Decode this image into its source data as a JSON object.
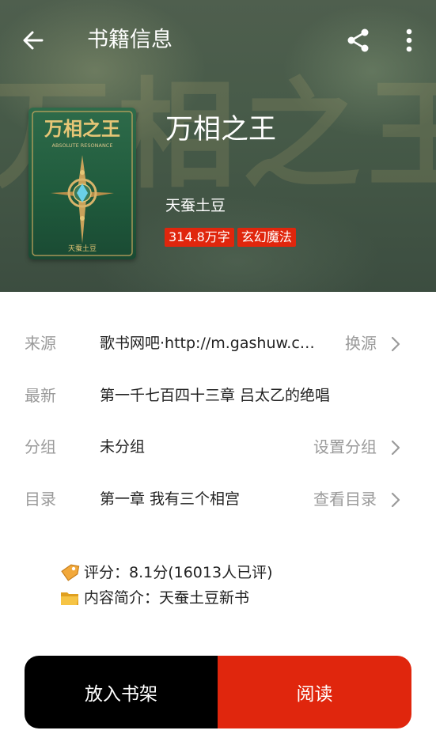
{
  "topbar": {
    "title": "书籍信息",
    "back_icon": "arrow-left-icon",
    "share_icon": "share-icon",
    "more_icon": "more-vertical-icon"
  },
  "book": {
    "title": "万相之王",
    "author": "天蚕土豆",
    "word_count": "314.8万字",
    "category": "玄幻魔法",
    "cover": {
      "title": "万相之王",
      "subtitle": "ABSOLUTE RESONANCE",
      "author": "天蚕土豆"
    }
  },
  "info_rows": {
    "source": {
      "label": "来源",
      "value": "歌书网吧·http://m.gashuw.com",
      "action": "换源"
    },
    "latest": {
      "label": "最新",
      "value": "第一千七百四十三章 吕太乙的绝唱"
    },
    "group": {
      "label": "分组",
      "value": "未分组",
      "action": "设置分组"
    },
    "toc": {
      "label": "目录",
      "value": "第一章 我有三个相宫",
      "action": "查看目录"
    }
  },
  "meta": {
    "rating": "评分：8.1分(16013人已评)",
    "intro": "内容简介：天蚕土豆新书",
    "rating_icon": "tag-icon",
    "intro_icon": "folder-icon"
  },
  "actions": {
    "add_shelf": "放入书架",
    "read": "阅读"
  },
  "colors": {
    "accent": "#e0260d",
    "dark": "#000000",
    "label_gray": "#9a9a9a"
  }
}
